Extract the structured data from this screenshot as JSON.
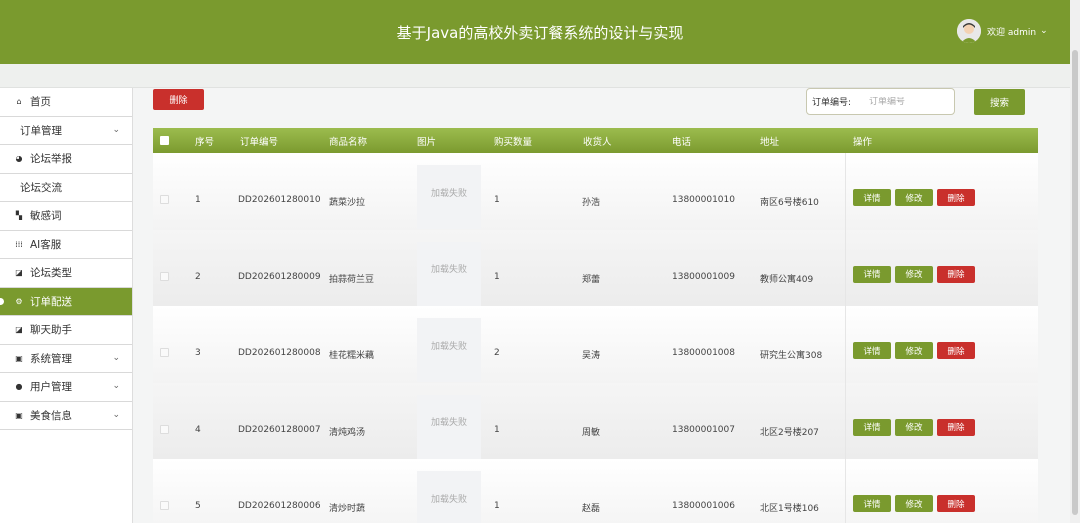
{
  "header": {
    "title": "基于Java的高校外卖订餐系统的设计与实现",
    "welcome": "欢迎 admin"
  },
  "colors": {
    "primary": "#7a9a2e",
    "danger": "#c9302c"
  },
  "sidebar": {
    "items": [
      {
        "label": "首页",
        "icon": "home-icon"
      },
      {
        "label": "订单管理",
        "icon": "",
        "expandable": true
      },
      {
        "label": "论坛举报",
        "icon": "pie-icon"
      },
      {
        "label": "论坛交流",
        "icon": ""
      },
      {
        "label": "敏感词",
        "icon": "grid-icon"
      },
      {
        "label": "AI客服",
        "icon": "apps-icon"
      },
      {
        "label": "论坛类型",
        "icon": "note-icon"
      },
      {
        "label": "订单配送",
        "icon": "gear-icon",
        "active": true
      },
      {
        "label": "聊天助手",
        "icon": "note-icon"
      },
      {
        "label": "系统管理",
        "icon": "book-icon",
        "expandable": true
      },
      {
        "label": "用户管理",
        "icon": "user-icon",
        "expandable": true
      },
      {
        "label": "美食信息",
        "icon": "book-icon",
        "expandable": true
      }
    ]
  },
  "toolbar": {
    "delete_label": "删除",
    "search_label": "订单编号:",
    "search_placeholder": "订单编号",
    "search_button": "搜索"
  },
  "table": {
    "columns": [
      "序号",
      "订单编号",
      "商品名称",
      "图片",
      "购买数量",
      "收货人",
      "电话",
      "地址",
      "操作"
    ],
    "image_fail_text": "加载失败",
    "actions": {
      "detail": "详情",
      "edit": "修改",
      "delete": "删除"
    },
    "rows": [
      {
        "index": "1",
        "order_no": "DD202601280010",
        "product": "蔬菜沙拉",
        "qty": "1",
        "receiver": "孙浩",
        "phone": "13800001010",
        "address": "南区6号楼610"
      },
      {
        "index": "2",
        "order_no": "DD202601280009",
        "product": "拍蒜荷兰豆",
        "qty": "1",
        "receiver": "郑蕾",
        "phone": "13800001009",
        "address": "教师公寓409"
      },
      {
        "index": "3",
        "order_no": "DD202601280008",
        "product": "桂花糯米藕",
        "qty": "2",
        "receiver": "吴涛",
        "phone": "13800001008",
        "address": "研究生公寓308"
      },
      {
        "index": "4",
        "order_no": "DD202601280007",
        "product": "清炖鸡汤",
        "qty": "1",
        "receiver": "周敏",
        "phone": "13800001007",
        "address": "北区2号楼207"
      },
      {
        "index": "5",
        "order_no": "DD202601280006",
        "product": "清炒时蔬",
        "qty": "1",
        "receiver": "赵磊",
        "phone": "13800001006",
        "address": "北区1号楼106"
      }
    ]
  }
}
